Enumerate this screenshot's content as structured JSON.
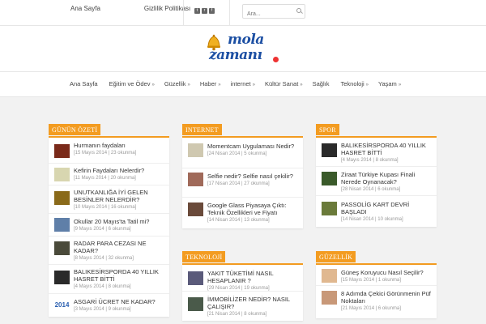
{
  "topbar": {
    "links": [
      "Ana Sayfa",
      "Gizlilik Politikası"
    ],
    "search_placeholder": "Ara..."
  },
  "logo": {
    "word1": "mola",
    "word2": "zamanı"
  },
  "nav": {
    "items": [
      {
        "label": "Ana Sayfa",
        "caret": ""
      },
      {
        "label": "Eğitim ve Ödev",
        "caret": "»"
      },
      {
        "label": "Güzellik",
        "caret": "»"
      },
      {
        "label": "Haber",
        "caret": "»"
      },
      {
        "label": "internet",
        "caret": "»"
      },
      {
        "label": "Kültür Sanat",
        "caret": "»"
      },
      {
        "label": "Sağlık",
        "caret": ""
      },
      {
        "label": "Teknoloji",
        "caret": "»"
      },
      {
        "label": "Yaşam",
        "caret": "»"
      }
    ]
  },
  "widgets": [
    {
      "title": "GÜNÜN ÖZETİ",
      "items": [
        {
          "title": "Hurmanın faydaları",
          "meta": "[15 Mayıs 2014 | 23 okunma]",
          "thumb": "#7a2a1a"
        },
        {
          "title": "Kefirin Faydaları Nelerdir?",
          "meta": "[11 Mayıs 2014 | 20 okunma]",
          "thumb": "#d8d6b0"
        },
        {
          "title": "UNUTKANLIĞA İYİ GELEN BESİNLER NELERDİR?",
          "meta": "[10 Mayıs 2014 | 16 okunma]",
          "thumb": "#8a6a1a"
        },
        {
          "title": "Okullar 20 Mayıs'ta Tatil mi?",
          "meta": "[9 Mayıs 2014 | 6 okunma]",
          "thumb": "#5f7fa8"
        },
        {
          "title": "RADAR PARA CEZASI NE KADAR?",
          "meta": "[8 Mayıs 2014 | 32 okunma]",
          "thumb": "#4a4a3a"
        },
        {
          "title": "BALIKESİRSPORDA 40 YILLIK HASRET BİTTİ",
          "meta": "[4 Mayıs 2014 | 8 okunma]",
          "thumb": "#2a2a2a"
        },
        {
          "title": "ASGARİ ÜCRET NE KADAR?",
          "meta": "[3 Mayıs 2014 | 9 okunma]",
          "thumb": "#2a5fb0"
        }
      ]
    },
    {
      "title": "INTERNET",
      "items": [
        {
          "title": "Momentcam Uygulaması Nedir?",
          "meta": "[24 Nisan 2014 | 5 okunma]",
          "thumb": "#cfc8b0"
        },
        {
          "title": "Selfie nedir? Selfie nasıl çekilir?",
          "meta": "[17 Nisan 2014 | 27 okunma]",
          "thumb": "#a06a5a"
        },
        {
          "title": "Google Glass Piyasaya Çıktı: Teknik Özellikleri ve Fiyatı",
          "meta": "[14 Nisan 2014 | 13 okunma]",
          "thumb": "#6a4a3a"
        }
      ]
    },
    {
      "title": "SPOR",
      "items": [
        {
          "title": "BALIKESİRSPORDA 40 YILLIK HASRET BİTTİ",
          "meta": "[4 Mayıs 2014 | 8 okunma]",
          "thumb": "#2a2a2a"
        },
        {
          "title": "Ziraat Türkiye Kupası Finali Nerede Oynanacak?",
          "meta": "[28 Nisan 2014 | 6 okunma]",
          "thumb": "#3a5a2a"
        },
        {
          "title": "PASSOLİG KART DEVRİ BAŞLADI",
          "meta": "[14 Nisan 2014 | 10 okunma]",
          "thumb": "#6a7a3a"
        }
      ]
    },
    {
      "title": "TEKNOLOJİ",
      "items": [
        {
          "title": "YAKIT TÜKETİMİ NASIL HESAPLANIR ?",
          "meta": "[29 Nisan 2014 | 19 okunma]",
          "thumb": "#5a5a7a"
        },
        {
          "title": "İMMOBİLİZER NEDİR? NASIL ÇALIŞIR?",
          "meta": "[21 Nisan 2014 | 8 okunma]",
          "thumb": "#4a5a4a"
        }
      ]
    },
    {
      "title": "GÜZELLİK",
      "items": [
        {
          "title": "Güneş Koruyucu Nasıl Seçilir?",
          "meta": "[15 Mayıs 2014 | 1 okunma]",
          "thumb": "#e0b890"
        },
        {
          "title": "8 Adımda Çekici Görünmenin Püf Noktaları",
          "meta": "[21 Mayıs 2014 | 6 okunma]",
          "thumb": "#c89878"
        }
      ]
    }
  ]
}
